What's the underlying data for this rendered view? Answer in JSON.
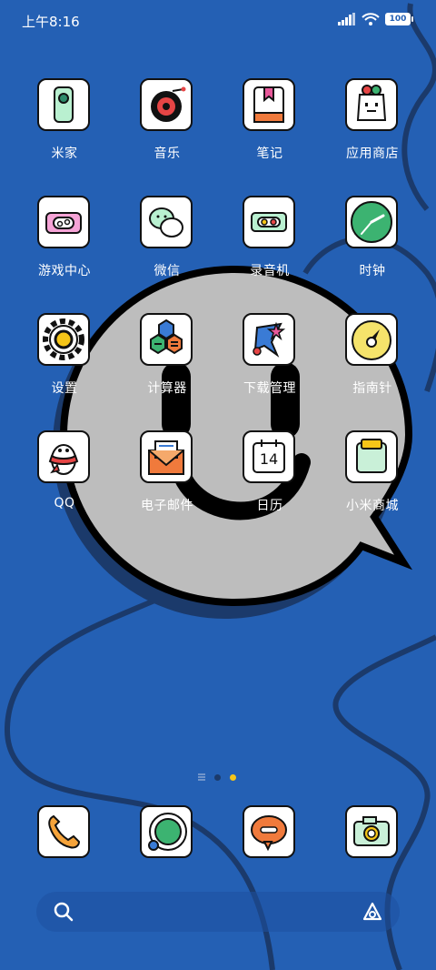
{
  "status_bar": {
    "time": "上午8:16",
    "battery": "100"
  },
  "apps": [
    {
      "label": "米家"
    },
    {
      "label": "音乐"
    },
    {
      "label": "笔记"
    },
    {
      "label": "应用商店"
    },
    {
      "label": "游戏中心"
    },
    {
      "label": "微信"
    },
    {
      "label": "录音机"
    },
    {
      "label": "时钟"
    },
    {
      "label": "设置"
    },
    {
      "label": "计算器"
    },
    {
      "label": "下载管理"
    },
    {
      "label": "指南针"
    },
    {
      "label": "QQ"
    },
    {
      "label": "电子邮件"
    },
    {
      "label": "日历"
    },
    {
      "label": "小米商城"
    }
  ],
  "calendar_day": "14",
  "dock": [
    {
      "icon": "phone-icon"
    },
    {
      "icon": "browser-icon"
    },
    {
      "icon": "messages-icon"
    },
    {
      "icon": "camera-icon"
    }
  ],
  "page_indicator": {
    "pages": 2,
    "current": 2
  },
  "colors": {
    "background": "#2460b4",
    "accent": "#f5c518"
  }
}
